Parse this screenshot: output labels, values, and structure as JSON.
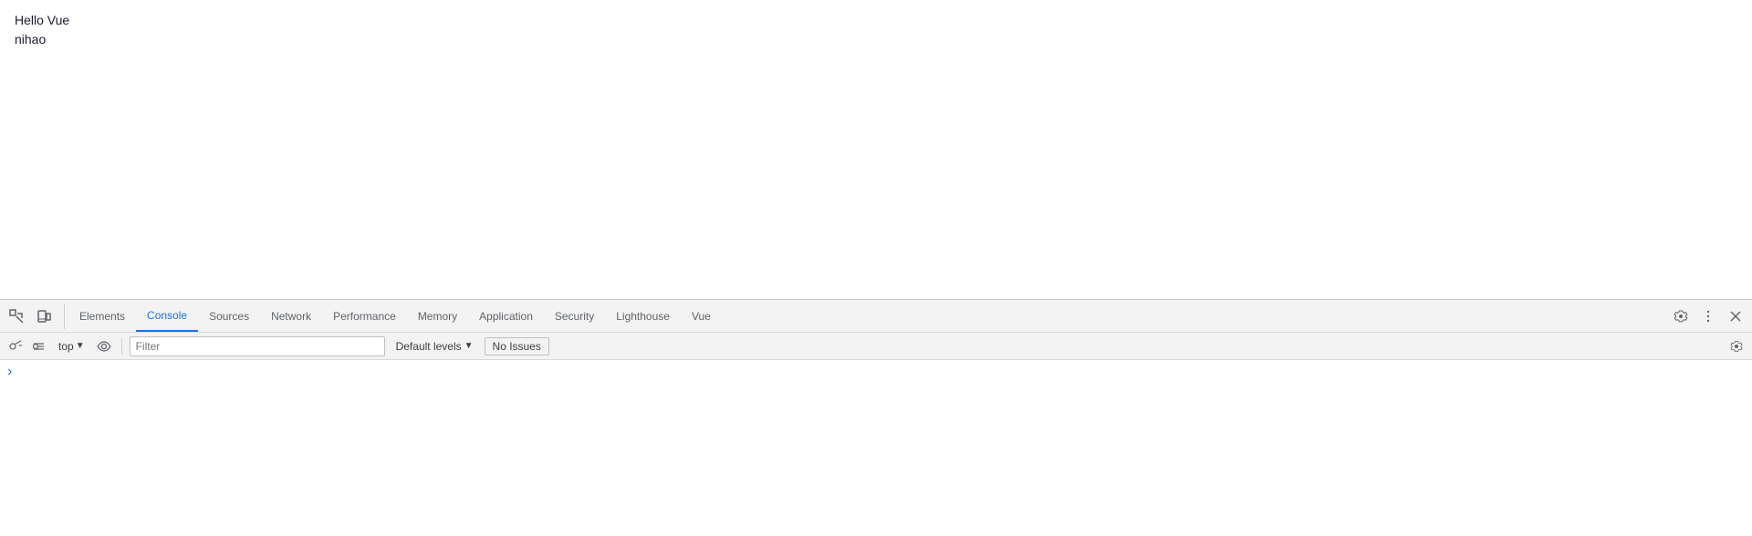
{
  "page": {
    "line1": "Hello Vue",
    "line2": "nihao"
  },
  "devtools": {
    "tabs": [
      {
        "id": "elements",
        "label": "Elements",
        "active": false
      },
      {
        "id": "console",
        "label": "Console",
        "active": true
      },
      {
        "id": "sources",
        "label": "Sources",
        "active": false
      },
      {
        "id": "network",
        "label": "Network",
        "active": false
      },
      {
        "id": "performance",
        "label": "Performance",
        "active": false
      },
      {
        "id": "memory",
        "label": "Memory",
        "active": false
      },
      {
        "id": "application",
        "label": "Application",
        "active": false
      },
      {
        "id": "security",
        "label": "Security",
        "active": false
      },
      {
        "id": "lighthouse",
        "label": "Lighthouse",
        "active": false
      },
      {
        "id": "vue",
        "label": "Vue",
        "active": false
      }
    ],
    "console": {
      "top_dropdown": "top",
      "filter_placeholder": "Filter",
      "default_levels": "Default levels",
      "no_issues": "No Issues",
      "prompt_icon": "›"
    }
  }
}
